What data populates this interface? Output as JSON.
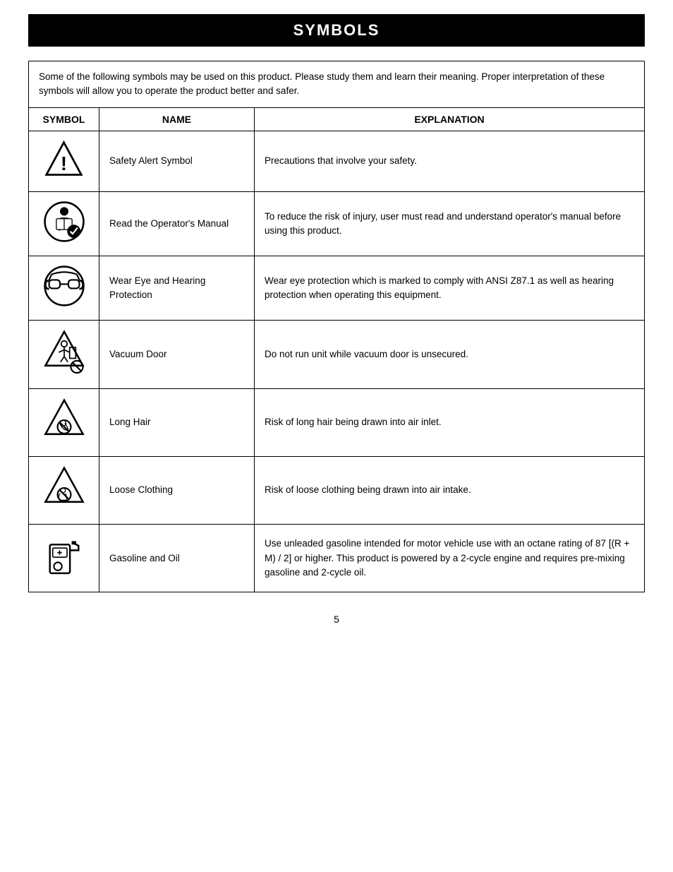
{
  "page": {
    "title": "SYMBOLS",
    "page_number": "5",
    "intro": "Some of the following symbols may be used on this product. Please study them and learn their meaning. Proper interpretation of these symbols will allow you to operate the product better and safer.",
    "table": {
      "headers": [
        "SYMBOL",
        "NAME",
        "EXPLANATION"
      ],
      "rows": [
        {
          "name": "Safety Alert Symbol",
          "explanation": "Precautions that involve your safety.",
          "icon": "safety-alert"
        },
        {
          "name": "Read the Operator's Manual",
          "explanation": "To reduce the risk of injury, user must read and understand operator's manual before using this product.",
          "icon": "read-manual"
        },
        {
          "name": "Wear Eye and Hearing Protection",
          "explanation": "Wear eye protection which is marked to comply with ANSI Z87.1 as well as hearing protection when operating this equipment.",
          "icon": "eye-hearing"
        },
        {
          "name": "Vacuum Door",
          "explanation": "Do not run unit while vacuum door is unsecured.",
          "icon": "vacuum-door"
        },
        {
          "name": "Long Hair",
          "explanation": "Risk of long hair being drawn into air inlet.",
          "icon": "long-hair"
        },
        {
          "name": "Loose Clothing",
          "explanation": "Risk of loose clothing being drawn into air intake.",
          "icon": "loose-clothing"
        },
        {
          "name": "Gasoline and Oil",
          "explanation": "Use unleaded gasoline intended for motor vehicle use with an octane rating of 87 [(R + M) / 2] or higher. This product is powered by a 2-cycle engine and requires pre-mixing gasoline and 2-cycle oil.",
          "icon": "gasoline-oil"
        }
      ]
    }
  }
}
